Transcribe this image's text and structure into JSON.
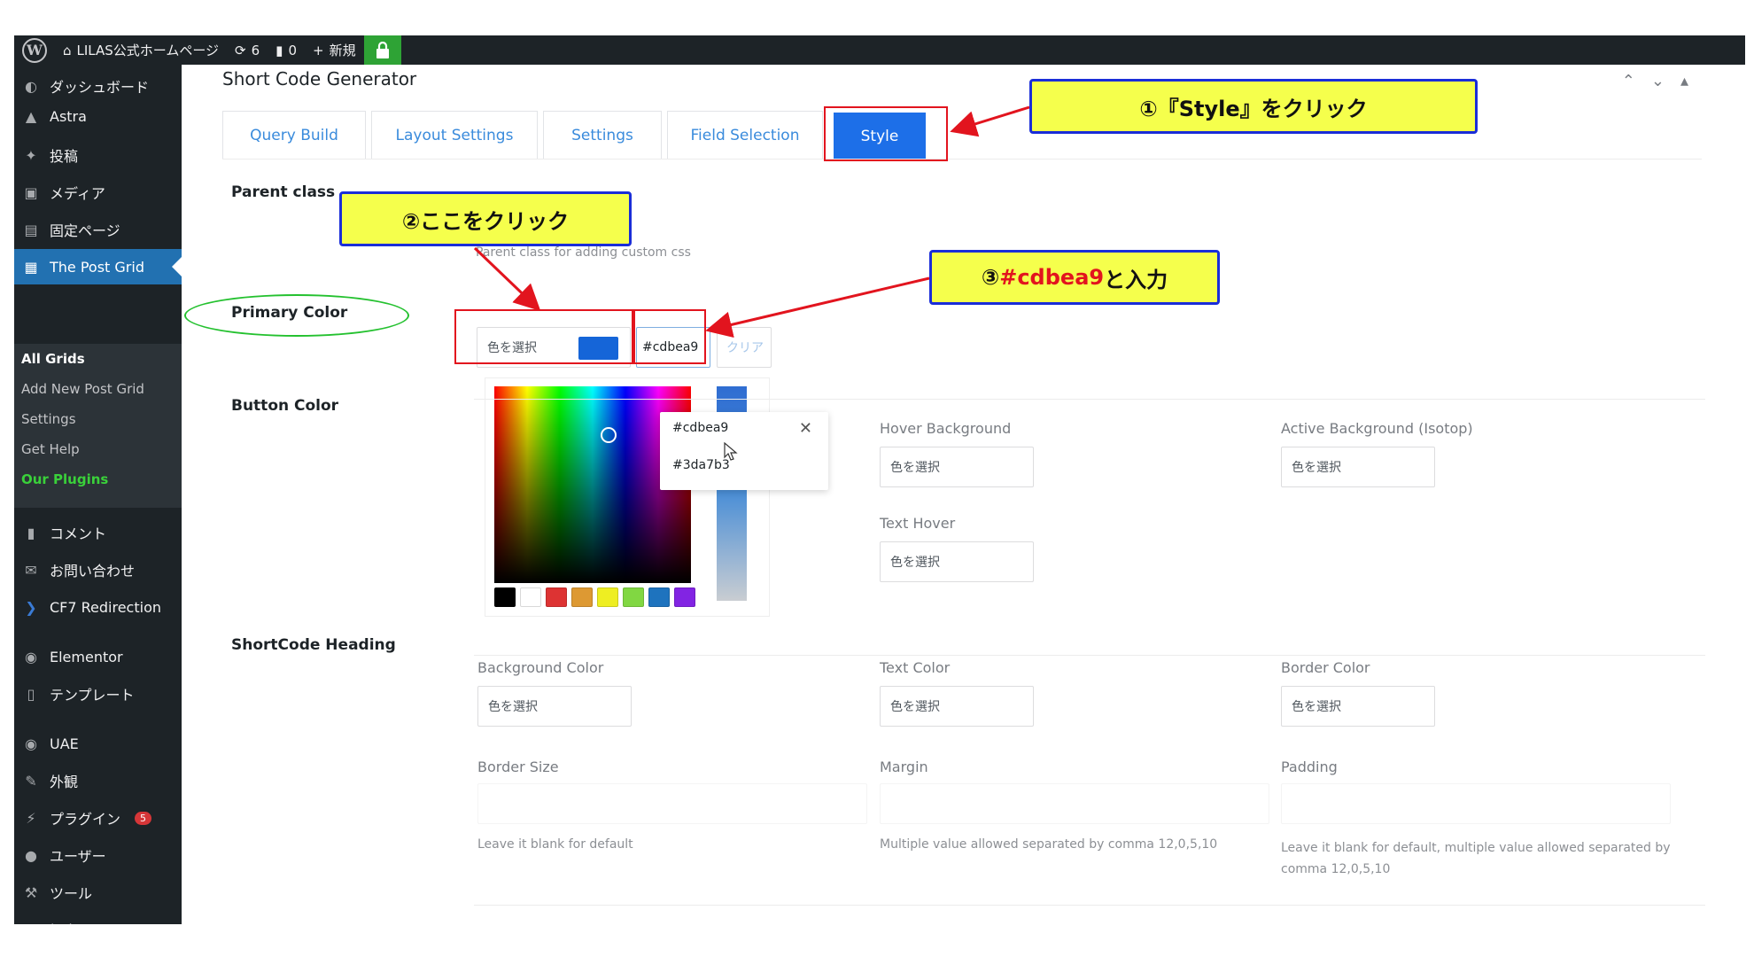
{
  "admin_bar": {
    "site_name": "LILAS公式ホームページ",
    "updates_count": "6",
    "comments_count": "0",
    "new_label": "新規"
  },
  "sidebar": {
    "items": [
      {
        "label": "ダッシュボード",
        "icon": "gauge-icon"
      },
      {
        "label": "Astra",
        "icon": "astra-icon"
      },
      {
        "label": "投稿",
        "icon": "pin-icon"
      },
      {
        "label": "メディア",
        "icon": "media-icon"
      },
      {
        "label": "固定ページ",
        "icon": "page-icon"
      },
      {
        "label": "The Post Grid",
        "icon": "grid-icon"
      },
      {
        "label": "コメント",
        "icon": "comment-icon"
      },
      {
        "label": "お問い合わせ",
        "icon": "mail-icon"
      },
      {
        "label": "CF7 Redirection",
        "icon": "redirect-icon"
      },
      {
        "label": "Elementor",
        "icon": "elementor-icon"
      },
      {
        "label": "テンプレート",
        "icon": "folder-icon"
      },
      {
        "label": "UAE",
        "icon": "uae-icon"
      },
      {
        "label": "外観",
        "icon": "brush-icon"
      },
      {
        "label": "プラグイン",
        "icon": "plugin-icon",
        "badge": "5"
      },
      {
        "label": "ユーザー",
        "icon": "user-icon"
      },
      {
        "label": "ツール",
        "icon": "wrench-icon"
      },
      {
        "label": "設定",
        "icon": "settings-icon"
      }
    ],
    "submenu": [
      "All Grids",
      "Add New Post Grid",
      "Settings",
      "Get Help",
      "Our Plugins"
    ]
  },
  "panel": {
    "title": "Short Code Generator",
    "tabs": [
      "Query Build",
      "Layout Settings",
      "Settings",
      "Field Selection",
      "Style"
    ],
    "active_tab": "Style"
  },
  "fields": {
    "parent_class_label": "Parent class",
    "parent_class_help": "Parent class for adding custom css",
    "primary_color_label": "Primary Color",
    "select_color": "色を選択",
    "primary_color_value": "#cdbea9",
    "clear_label": "クリア",
    "button_color_label": "Button Color",
    "hover_background_label": "Hover Background",
    "active_background_label": "Active Background (Isotop)",
    "text_hover_label": "Text Hover",
    "shortcode_heading_label": "ShortCode Heading",
    "background_color_label": "Background Color",
    "text_color_label": "Text Color",
    "border_color_label": "Border Color",
    "border_size_label": "Border Size",
    "margin_label": "Margin",
    "padding_label": "Padding",
    "border_size_help": "Leave it blank for default",
    "margin_help": "Multiple value allowed separated by comma 12,0,5,10",
    "padding_help": "Leave it blank for default, multiple value allowed separated by comma 12,0,5,10"
  },
  "autocomplete": {
    "options": [
      "#cdbea9",
      "#3da7b3"
    ]
  },
  "colors": {
    "primary_swatch": "#1565d8",
    "palette": [
      "#000000",
      "#ffffff",
      "#dd3333",
      "#dd9933",
      "#eeee22",
      "#81d742",
      "#1e73be",
      "#8224e3"
    ]
  },
  "annotations": {
    "step1": "①『Style』をクリック",
    "step2": "②ここをクリック",
    "step3_prefix": "③",
    "step3_value": "#cdbea9",
    "step3_suffix": "と入力"
  }
}
